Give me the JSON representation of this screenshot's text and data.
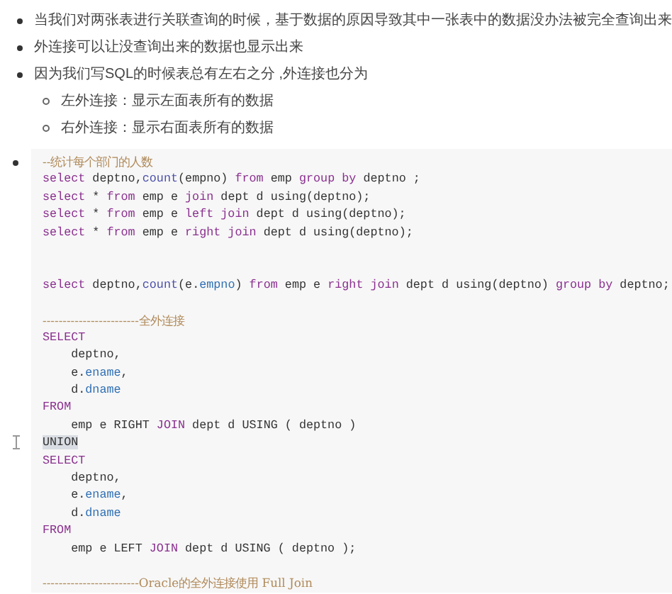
{
  "bullets": [
    {
      "text": "当我们对两张表进行关联查询的时候，基于数据的原因导致其中一张表中的数据没办法被完全查询出来"
    },
    {
      "text": "外连接可以让没查询出来的数据也显示出来"
    },
    {
      "text": "因为我们写SQL的时候表总有左右之分 ,外连接也分为",
      "children": [
        {
          "text": "左外连接：显示左面表所有的数据"
        },
        {
          "text": "右外连接：显示右面表所有的数据"
        }
      ]
    }
  ],
  "code_lines": [
    {
      "kind": "code",
      "tokens": [
        {
          "text": "--统计每个部门的人数",
          "kind": "comment"
        }
      ]
    },
    {
      "kind": "code",
      "tokens": [
        {
          "text": "select",
          "kind": "keyword"
        },
        {
          "text": " deptno,",
          "kind": "plain"
        },
        {
          "text": "count",
          "kind": "function"
        },
        {
          "text": "(empno) ",
          "kind": "plain"
        },
        {
          "text": "from",
          "kind": "keyword"
        },
        {
          "text": " emp ",
          "kind": "plain"
        },
        {
          "text": "group by",
          "kind": "keyword"
        },
        {
          "text": " deptno ;",
          "kind": "plain"
        }
      ]
    },
    {
      "kind": "code",
      "tokens": [
        {
          "text": "select",
          "kind": "keyword"
        },
        {
          "text": " * ",
          "kind": "plain"
        },
        {
          "text": "from",
          "kind": "keyword"
        },
        {
          "text": " emp e ",
          "kind": "plain"
        },
        {
          "text": "join",
          "kind": "keyword"
        },
        {
          "text": " dept d using(deptno);",
          "kind": "plain"
        }
      ]
    },
    {
      "kind": "code",
      "tokens": [
        {
          "text": "select",
          "kind": "keyword"
        },
        {
          "text": " * ",
          "kind": "plain"
        },
        {
          "text": "from",
          "kind": "keyword"
        },
        {
          "text": " emp e ",
          "kind": "plain"
        },
        {
          "text": "left join",
          "kind": "keyword"
        },
        {
          "text": " dept d using(deptno);",
          "kind": "plain"
        }
      ]
    },
    {
      "kind": "code",
      "tokens": [
        {
          "text": "select",
          "kind": "keyword"
        },
        {
          "text": " * ",
          "kind": "plain"
        },
        {
          "text": "from",
          "kind": "keyword"
        },
        {
          "text": " emp e ",
          "kind": "plain"
        },
        {
          "text": "right join",
          "kind": "keyword"
        },
        {
          "text": " dept d using(deptno);",
          "kind": "plain"
        }
      ]
    },
    {
      "kind": "blank"
    },
    {
      "kind": "blank"
    },
    {
      "kind": "code",
      "tokens": [
        {
          "text": "select",
          "kind": "keyword"
        },
        {
          "text": " deptno,",
          "kind": "plain"
        },
        {
          "text": "count",
          "kind": "function"
        },
        {
          "text": "(e.",
          "kind": "plain"
        },
        {
          "text": "empno",
          "kind": "property"
        },
        {
          "text": ") ",
          "kind": "plain"
        },
        {
          "text": "from",
          "kind": "keyword"
        },
        {
          "text": " emp e ",
          "kind": "plain"
        },
        {
          "text": "right join",
          "kind": "keyword"
        },
        {
          "text": " dept d using(deptno) ",
          "kind": "plain"
        },
        {
          "text": "group by",
          "kind": "keyword"
        },
        {
          "text": " deptno;",
          "kind": "plain"
        }
      ]
    },
    {
      "kind": "blank"
    },
    {
      "kind": "code",
      "tokens": [
        {
          "text": "------------------------全外连接",
          "kind": "comment"
        }
      ]
    },
    {
      "kind": "code",
      "tokens": [
        {
          "text": "SELECT",
          "kind": "keyword"
        }
      ]
    },
    {
      "kind": "code",
      "tokens": [
        {
          "text": "    deptno,",
          "kind": "plain"
        }
      ]
    },
    {
      "kind": "code",
      "tokens": [
        {
          "text": "    e.",
          "kind": "plain"
        },
        {
          "text": "ename",
          "kind": "property"
        },
        {
          "text": ",",
          "kind": "plain"
        }
      ]
    },
    {
      "kind": "code",
      "tokens": [
        {
          "text": "    d.",
          "kind": "plain"
        },
        {
          "text": "dname",
          "kind": "property"
        }
      ]
    },
    {
      "kind": "code",
      "tokens": [
        {
          "text": "FROM",
          "kind": "keyword"
        }
      ]
    },
    {
      "kind": "code",
      "tokens": [
        {
          "text": "    emp e RIGHT ",
          "kind": "plain"
        },
        {
          "text": "JOIN",
          "kind": "keyword"
        },
        {
          "text": " dept d USING ( deptno )",
          "kind": "plain"
        }
      ]
    },
    {
      "kind": "code",
      "tokens": [
        {
          "text": "UNION",
          "kind": "selected"
        }
      ]
    },
    {
      "kind": "code",
      "tokens": [
        {
          "text": "SELECT",
          "kind": "keyword"
        }
      ]
    },
    {
      "kind": "code",
      "tokens": [
        {
          "text": "    deptno,",
          "kind": "plain"
        }
      ]
    },
    {
      "kind": "code",
      "tokens": [
        {
          "text": "    e.",
          "kind": "plain"
        },
        {
          "text": "ename",
          "kind": "property"
        },
        {
          "text": ",",
          "kind": "plain"
        }
      ]
    },
    {
      "kind": "code",
      "tokens": [
        {
          "text": "    d.",
          "kind": "plain"
        },
        {
          "text": "dname",
          "kind": "property"
        }
      ]
    },
    {
      "kind": "code",
      "tokens": [
        {
          "text": "FROM",
          "kind": "keyword"
        }
      ]
    },
    {
      "kind": "code",
      "tokens": [
        {
          "text": "    emp e LEFT ",
          "kind": "plain"
        },
        {
          "text": "JOIN",
          "kind": "keyword"
        },
        {
          "text": " dept d USING ( deptno );",
          "kind": "plain"
        }
      ]
    },
    {
      "kind": "blank"
    },
    {
      "kind": "code",
      "tokens": [
        {
          "text": "------------------------Oracle的全外连接使用 Full Join",
          "kind": "comment"
        }
      ]
    }
  ]
}
